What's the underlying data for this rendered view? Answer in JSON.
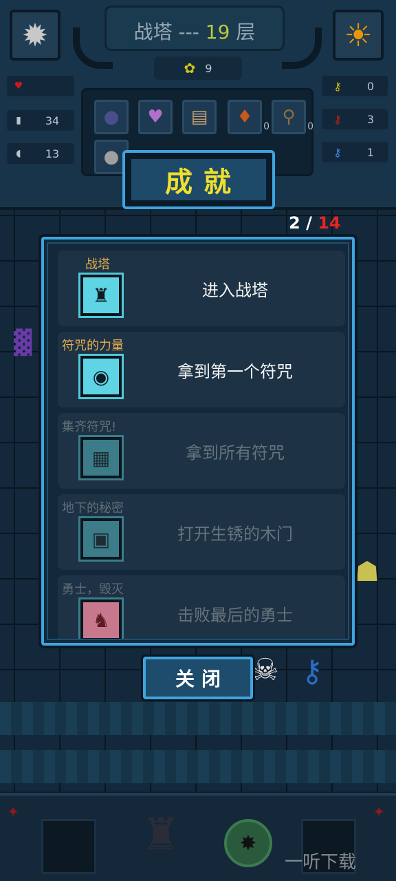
{
  "hud": {
    "title_prefix": "战塔 --- ",
    "floor_number": "19",
    "floor_suffix": " 层",
    "coins": "9",
    "stats_left": [
      {
        "name": "hp",
        "value": ""
      },
      {
        "name": "attack",
        "value": "34"
      },
      {
        "name": "defense",
        "value": "13"
      }
    ],
    "stats_right": [
      {
        "name": "yellow-key",
        "value": "0"
      },
      {
        "name": "red-key",
        "value": "3"
      },
      {
        "name": "blue-key",
        "value": "1"
      }
    ],
    "inventory": [
      {
        "icon": "slime-pot-icon",
        "count": ""
      },
      {
        "icon": "bat-mask-icon",
        "count": ""
      },
      {
        "icon": "map-scroll-icon",
        "count": ""
      },
      {
        "icon": "potion-icon",
        "count": "0"
      },
      {
        "icon": "magnifier-key-icon",
        "count": "0"
      },
      {
        "icon": "orb-icon",
        "count": ""
      }
    ]
  },
  "achievements": {
    "title": "成就",
    "progress_current": "2",
    "progress_sep": "/",
    "progress_total": "14",
    "items": [
      {
        "name": "战塔",
        "desc": "进入战塔",
        "icon": "tower-icon",
        "unlocked": true
      },
      {
        "name": "符咒的力量",
        "desc": "拿到第一个符咒",
        "icon": "charm-icon",
        "unlocked": true
      },
      {
        "name": "集齐符咒!",
        "desc": "拿到所有符咒",
        "icon": "grid-charm-icon",
        "unlocked": false
      },
      {
        "name": "地下的秘密",
        "desc": "打开生锈的木门",
        "icon": "door-icon",
        "unlocked": false
      },
      {
        "name": "勇士，毁灭",
        "desc": "击败最后的勇士",
        "icon": "crow-icon",
        "unlocked": false
      }
    ]
  },
  "close_label": "关闭",
  "watermark": "一听下载",
  "colors": {
    "accent": "#3ea4e0",
    "title_yellow": "#f0e02c",
    "name_orange": "#e8b050",
    "total_red": "#e82424"
  }
}
